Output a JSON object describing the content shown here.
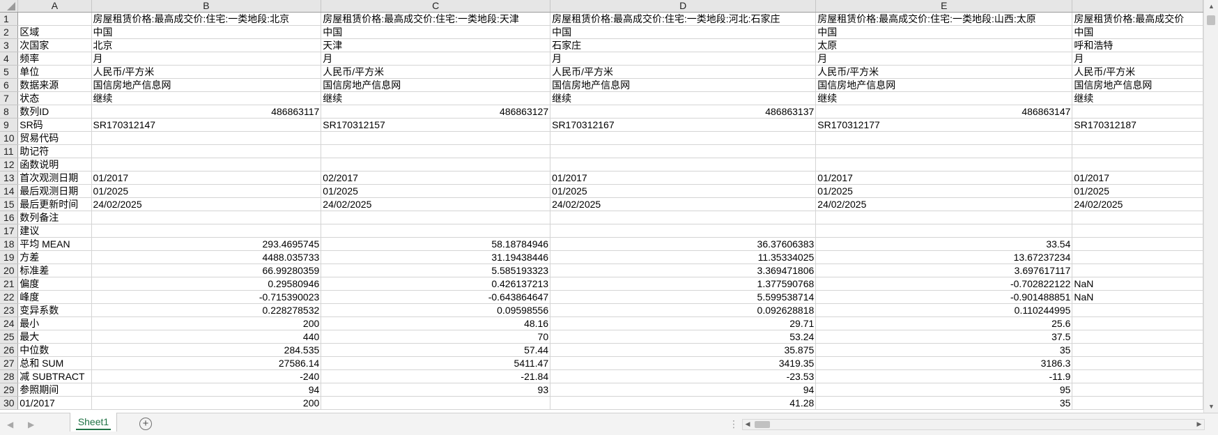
{
  "columns": [
    "A",
    "B",
    "C",
    "D",
    "E",
    ""
  ],
  "rows": [
    {
      "n": "1",
      "a": "",
      "b": "房屋租赁价格:最高成交价:住宅:一类地段:北京",
      "c": "房屋租赁价格:最高成交价:住宅:一类地段:天津",
      "d": "房屋租赁价格:最高成交价:住宅:一类地段:河北:石家庄",
      "e": "房屋租赁价格:最高成交价:住宅:一类地段:山西:太原",
      "f": "房屋租赁价格:最高成交价"
    },
    {
      "n": "2",
      "a": "区域",
      "b": "中国",
      "c": "中国",
      "d": "中国",
      "e": "中国",
      "f": "中国"
    },
    {
      "n": "3",
      "a": "次国家",
      "b": "北京",
      "c": "天津",
      "d": "石家庄",
      "e": "太原",
      "f": "呼和浩特"
    },
    {
      "n": "4",
      "a": "频率",
      "b": "月",
      "c": "月",
      "d": "月",
      "e": "月",
      "f": "月"
    },
    {
      "n": "5",
      "a": "单位",
      "b": "人民币/平方米",
      "c": "人民币/平方米",
      "d": "人民币/平方米",
      "e": "人民币/平方米",
      "f": "人民币/平方米"
    },
    {
      "n": "6",
      "a": "数据来源",
      "b": "国信房地产信息网",
      "c": "国信房地产信息网",
      "d": "国信房地产信息网",
      "e": "国信房地产信息网",
      "f": "国信房地产信息网"
    },
    {
      "n": "7",
      "a": "状态",
      "b": "继续",
      "c": "继续",
      "d": "继续",
      "e": "继续",
      "f": "继续"
    },
    {
      "n": "8",
      "a": "数列ID",
      "b": "486863117",
      "c": "486863127",
      "d": "486863137",
      "e": "486863147",
      "f": ""
    },
    {
      "n": "9",
      "a": "SR码",
      "b": "SR170312147",
      "c": "SR170312157",
      "d": "SR170312167",
      "e": "SR170312177",
      "f": "SR170312187"
    },
    {
      "n": "10",
      "a": "贸易代码",
      "b": "",
      "c": "",
      "d": "",
      "e": "",
      "f": ""
    },
    {
      "n": "11",
      "a": "助记符",
      "b": "",
      "c": "",
      "d": "",
      "e": "",
      "f": ""
    },
    {
      "n": "12",
      "a": "函数说明",
      "b": "",
      "c": "",
      "d": "",
      "e": "",
      "f": ""
    },
    {
      "n": "13",
      "a": "首次观测日期",
      "b": "01/2017",
      "c": "02/2017",
      "d": "01/2017",
      "e": "01/2017",
      "f": "01/2017"
    },
    {
      "n": "14",
      "a": "最后观测日期",
      "b": "01/2025",
      "c": "01/2025",
      "d": "01/2025",
      "e": "01/2025",
      "f": "01/2025"
    },
    {
      "n": "15",
      "a": "最后更新时间",
      "b": "24/02/2025",
      "c": "24/02/2025",
      "d": "24/02/2025",
      "e": "24/02/2025",
      "f": "24/02/2025"
    },
    {
      "n": "16",
      "a": "数列备注",
      "b": "",
      "c": "",
      "d": "",
      "e": "",
      "f": ""
    },
    {
      "n": "17",
      "a": "建议",
      "b": "",
      "c": "",
      "d": "",
      "e": "",
      "f": ""
    },
    {
      "n": "18",
      "a": "平均 MEAN",
      "b": "293.4695745",
      "c": "58.18784946",
      "d": "36.37606383",
      "e": "33.54",
      "f": ""
    },
    {
      "n": "19",
      "a": "方差",
      "b": "4488.035733",
      "c": "31.19438446",
      "d": "11.35334025",
      "e": "13.67237234",
      "f": ""
    },
    {
      "n": "20",
      "a": "标准差",
      "b": "66.99280359",
      "c": "5.585193323",
      "d": "3.369471806",
      "e": "3.697617117",
      "f": ""
    },
    {
      "n": "21",
      "a": "偏度",
      "b": "0.29580946",
      "c": "0.426137213",
      "d": "1.377590768",
      "e": "-0.702822122",
      "f": "NaN"
    },
    {
      "n": "22",
      "a": "峰度",
      "b": "-0.715390023",
      "c": "-0.643864647",
      "d": "5.599538714",
      "e": "-0.901488851",
      "f": "NaN"
    },
    {
      "n": "23",
      "a": "变异系数",
      "b": "0.228278532",
      "c": "0.09598556",
      "d": "0.092628818",
      "e": "0.110244995",
      "f": ""
    },
    {
      "n": "24",
      "a": "最小",
      "b": "200",
      "c": "48.16",
      "d": "29.71",
      "e": "25.6",
      "f": ""
    },
    {
      "n": "25",
      "a": "最大",
      "b": "440",
      "c": "70",
      "d": "53.24",
      "e": "37.5",
      "f": ""
    },
    {
      "n": "26",
      "a": "中位数",
      "b": "284.535",
      "c": "57.44",
      "d": "35.875",
      "e": "35",
      "f": ""
    },
    {
      "n": "27",
      "a": "总和 SUM",
      "b": "27586.14",
      "c": "5411.47",
      "d": "3419.35",
      "e": "3186.3",
      "f": ""
    },
    {
      "n": "28",
      "a": "减 SUBTRACT",
      "b": "-240",
      "c": "-21.84",
      "d": "-23.53",
      "e": "-11.9",
      "f": ""
    },
    {
      "n": "29",
      "a": "参照期间",
      "b": "94",
      "c": "93",
      "d": "94",
      "e": "95",
      "f": ""
    },
    {
      "n": "30",
      "a": "01/2017",
      "b": "200",
      "c": "",
      "d": "41.28",
      "e": "35",
      "f": ""
    }
  ],
  "sheet_tabs": [
    {
      "label": "Sheet1",
      "active": true
    }
  ],
  "add_sheet_symbol": "+",
  "colors": {
    "accent": "#217346",
    "header_bg": "#e6e6e6",
    "grid_line": "#d4d4d4"
  }
}
